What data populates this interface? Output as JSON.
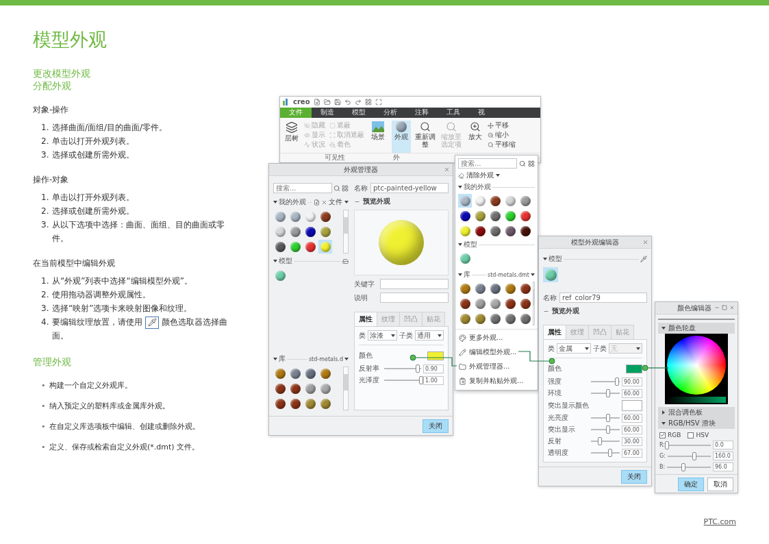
{
  "page_title": "模型外观",
  "subtitles": [
    "更改模型外观",
    "分配外观"
  ],
  "sections": [
    {
      "heading": "对象-操作",
      "items": [
        {
          "kind": "text",
          "num": "1.",
          "text": "选择曲面/面组/目的曲面/零件。"
        },
        {
          "kind": "text",
          "num": "2.",
          "text": "单击以打开外观列表。"
        },
        {
          "kind": "text",
          "num": "3.",
          "text": "选择或创建所需外观。"
        }
      ]
    },
    {
      "heading": "操作-对象",
      "items": [
        {
          "kind": "text",
          "num": "1.",
          "text": "单击以打开外观列表。"
        },
        {
          "kind": "text",
          "num": "2.",
          "text": "选择或创建所需外观。"
        },
        {
          "kind": "text",
          "num": "3.",
          "text": "从以下选项中选择：曲面、面组、目的曲面或零件。"
        }
      ]
    },
    {
      "heading": "在当前模型中编辑外观",
      "items": [
        {
          "kind": "text",
          "num": "1.",
          "text": "从“外观”列表中选择“编辑模型外观”。"
        },
        {
          "kind": "text",
          "num": "2.",
          "text": "使用拖动器调整外观属性。"
        },
        {
          "kind": "text",
          "num": "3.",
          "text": "选择“映射”选项卡来映射图像和纹理。"
        },
        {
          "kind": "picker",
          "num": "4.",
          "text": "要编辑纹理放置，请使用",
          "after": "颜色选取器选择曲面。"
        }
      ]
    }
  ],
  "manage": {
    "heading": "管理外观",
    "items": [
      {
        "bullet": "•",
        "text": "构建一个自定义外观库。"
      },
      {
        "bullet": "•",
        "text": "纳入预定义的塑料库或金属库外观。"
      },
      {
        "bullet": "•",
        "text": "在自定义库选项板中编辑、创建或删除外观。"
      },
      {
        "bullet": "•",
        "text": "定义、保存或检索自定义外观(*.dmt) 文件。"
      }
    ]
  },
  "footer_link": "PTC.com",
  "ribbon": {
    "logo": "creo",
    "tabs": [
      {
        "label": "文件",
        "selected": true
      },
      {
        "label": "制造",
        "selected": false
      },
      {
        "label": "模型",
        "selected": false
      },
      {
        "label": "分析",
        "selected": false
      },
      {
        "label": "注释",
        "selected": false
      },
      {
        "label": "工具",
        "selected": false
      },
      {
        "label": "视",
        "selected": false
      }
    ],
    "layer_tree": "层树",
    "visibility": [
      {
        "label": "隐藏",
        "disabled": true
      },
      {
        "label": "显示",
        "disabled": true
      },
      {
        "label": "状况",
        "disabled": true
      },
      {
        "label": "遮蔽",
        "disabled": true
      },
      {
        "label": "取消遮蔽",
        "disabled": true
      },
      {
        "label": "着色",
        "disabled": true
      }
    ],
    "visibility_group": "可见性",
    "scene": "场景",
    "appearance": {
      "label": "外观",
      "selected": true
    },
    "refit": "重新调整",
    "zoom_selected": {
      "label": "缩放至选定项",
      "disabled": true
    },
    "zoom_in": "放大",
    "pan": [
      "平移",
      "缩小",
      "平移缩"
    ],
    "appearance_group": "外"
  },
  "gallery": {
    "search_placeholder": "搜索...",
    "clear": "清除外观",
    "my_heading": "我的外观",
    "my_swatches": [
      {
        "color": "#a9b6c4",
        "selected": true
      },
      {
        "color": "#f2f2f2",
        "selected": false
      },
      {
        "color": "#8c3c1e",
        "selected": false
      },
      {
        "color": "#d6d6d6",
        "selected": false
      },
      {
        "color": "#9a9a9a",
        "selected": false
      },
      {
        "color": "#0a0ab4",
        "selected": false
      },
      {
        "color": "#a8a23e",
        "selected": false
      },
      {
        "color": "#707070",
        "selected": false
      },
      {
        "color": "#2fd02f",
        "selected": false
      },
      {
        "color": "#e83232",
        "selected": false
      },
      {
        "color": "#f0f032",
        "selected": false
      },
      {
        "color": "#8a0c0c",
        "selected": false
      },
      {
        "color": "#6e6e6e",
        "selected": false
      },
      {
        "color": "#6e5a6a",
        "selected": false
      },
      {
        "color": "#4a120a",
        "selected": false
      }
    ],
    "model_heading": "模型",
    "model_swatches": [
      {
        "color": "#6ccfa8",
        "selected": false
      }
    ],
    "library_heading": "库",
    "library_file": "std-metals.dmt",
    "library_swatches": [
      {
        "color": "#b07a12",
        "selected": false
      },
      {
        "color": "#7a8292",
        "selected": false
      },
      {
        "color": "#6a7282",
        "selected": false
      },
      {
        "color": "#b07a12",
        "selected": false
      },
      {
        "color": "#8c3418",
        "selected": false
      },
      {
        "color": "#8c3418",
        "selected": false
      },
      {
        "color": "#a0a0a0",
        "selected": false
      },
      {
        "color": "#a8a8a8",
        "selected": false
      },
      {
        "color": "#8c3418",
        "selected": false
      },
      {
        "color": "#8c3418",
        "selected": false
      },
      {
        "color": "#a08a32",
        "selected": false
      },
      {
        "color": "#a08a32",
        "selected": false
      },
      {
        "color": "#727272",
        "selected": false
      },
      {
        "color": "#727272",
        "selected": false
      },
      {
        "color": "#727272",
        "selected": false
      }
    ],
    "menu": [
      "更多外观...",
      "编辑模型外观...",
      "外观管理器...",
      "复制并粘贴外观..."
    ]
  },
  "manager": {
    "title": "外观管理器",
    "search_placeholder": "搜索...",
    "my_heading": "我的外观",
    "file_menu": "文件",
    "my_swatches": [
      {
        "color": "#a9b6c4",
        "selected": false
      },
      {
        "color": "#a9b6c4",
        "selected": false
      },
      {
        "color": "#f2f2f2",
        "selected": false
      },
      {
        "color": "#8c3c1e",
        "selected": false
      },
      {
        "color": "#d6d6d6",
        "selected": false
      },
      {
        "color": "#9a9a9a",
        "selected": false
      },
      {
        "color": "#0a0ab4",
        "selected": false
      },
      {
        "color": "#a8a23e",
        "selected": false
      },
      {
        "color": "#5a5a5a",
        "selected": false
      },
      {
        "color": "#2fd02f",
        "selected": false
      },
      {
        "color": "#e83232",
        "selected": false
      },
      {
        "color": "#f0f032",
        "selected": true
      }
    ],
    "model_heading": "模型",
    "model_swatches": [
      {
        "color": "#6ccfa8",
        "selected": false
      }
    ],
    "library_heading": "库",
    "library_file": "std-metals.d",
    "library_swatches": [
      {
        "color": "#b07a12",
        "selected": false
      },
      {
        "color": "#7a8292",
        "selected": false
      },
      {
        "color": "#6a7282",
        "selected": false
      },
      {
        "color": "#b07a12",
        "selected": false
      },
      {
        "color": "#8c3418",
        "selected": false
      },
      {
        "color": "#8c3418",
        "selected": false
      },
      {
        "color": "#a0a0a0",
        "selected": false
      },
      {
        "color": "#a8a8a8",
        "selected": false
      },
      {
        "color": "#8c3418",
        "selected": false
      },
      {
        "color": "#8c3418",
        "selected": false
      },
      {
        "color": "#a08a32",
        "selected": false
      },
      {
        "color": "#a08a32",
        "selected": false
      }
    ],
    "name_label": "名称",
    "name": "ptc-painted-yellow",
    "preview_label": "预览外观",
    "keyword_label": "关键字",
    "description_label": "说明",
    "tabs": [
      {
        "label": "属性",
        "selected": true
      },
      {
        "label": "纹理",
        "selected": false
      },
      {
        "label": "凹凸",
        "selected": false
      },
      {
        "label": "贴花",
        "selected": false
      }
    ],
    "class_label": "类",
    "class_value": "涂漆",
    "subclass_label": "子类",
    "subclass_value": "通用",
    "subclass_disabled": false,
    "color_label": "颜色",
    "properties": [
      {
        "kind": "slider",
        "label": "反射率",
        "level": 0.9,
        "value": "0.90"
      },
      {
        "kind": "slider",
        "label": "光泽度",
        "level": 1,
        "value": "1.00"
      }
    ],
    "close": "关闭"
  },
  "editor": {
    "title": "模型外观编辑器",
    "model_heading": "模型",
    "swatches": [
      {
        "color": "#6ccfa8",
        "selected": true
      }
    ],
    "name_label": "名称",
    "name": "ref_color79",
    "preview_label": "预览外观",
    "tabs": [
      {
        "label": "属性",
        "selected": true
      },
      {
        "label": "纹理",
        "selected": false
      },
      {
        "label": "凹凸",
        "selected": false
      },
      {
        "label": "贴花",
        "selected": false
      }
    ],
    "class_label": "类",
    "class_value": "金属",
    "subclass_label": "子类",
    "subclass_value": "无",
    "subclass_disabled": true,
    "color_label": "颜色",
    "properties": [
      {
        "kind": "slider",
        "label": "强度",
        "level": 0.9,
        "value": "90.00"
      },
      {
        "kind": "slider",
        "label": "环境",
        "level": 0.6,
        "value": "60.00"
      },
      {
        "kind": "swatch",
        "label": "突出显示颜色"
      },
      {
        "kind": "slider",
        "label": "光亮度",
        "level": 0.6,
        "value": "60.00"
      },
      {
        "kind": "slider",
        "label": "突出显示",
        "level": 0.6,
        "value": "60.00"
      },
      {
        "kind": "slider",
        "label": "反射",
        "level": 0.3,
        "value": "30.00"
      },
      {
        "kind": "slider",
        "label": "透明度",
        "level": 0.67,
        "value": "67.00"
      }
    ],
    "close": "关闭"
  },
  "color_editor": {
    "title": "颜色编辑器",
    "wheel_heading": "颜色轮盘",
    "wheel_expanded": true,
    "palette_heading": "混合调色板",
    "palette_expanded": false,
    "sliders_heading": "RGB/HSV 滑块",
    "sliders_expanded": true,
    "modes": [
      {
        "label": "RGB",
        "checked": true
      },
      {
        "label": "HSV",
        "checked": false
      }
    ],
    "channels": [
      {
        "label": "R:",
        "level": 0,
        "value": "0.0"
      },
      {
        "label": "G:",
        "level": 0.627,
        "value": "160.0"
      },
      {
        "label": "B:",
        "level": 0.376,
        "value": "96.0"
      }
    ],
    "ok": "确定",
    "cancel": "取消"
  }
}
